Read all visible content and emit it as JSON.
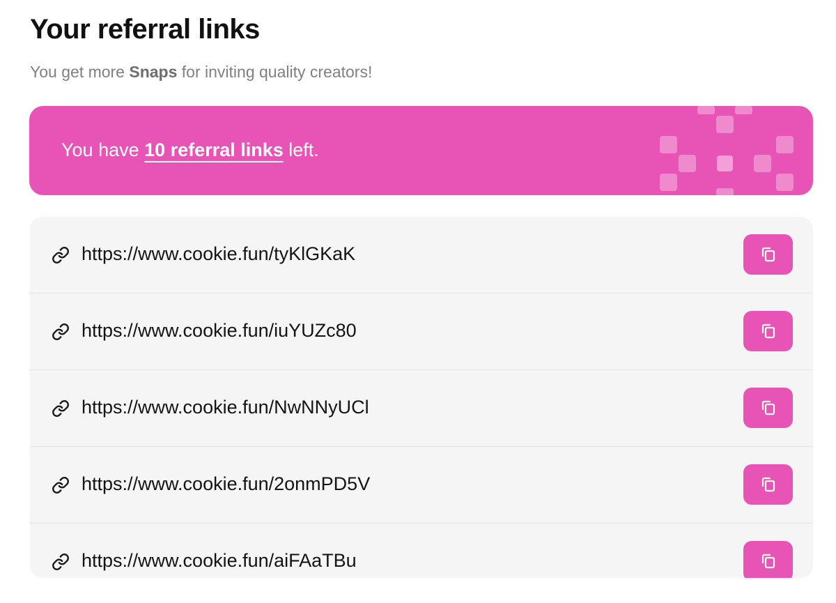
{
  "header": {
    "title": "Your referral links",
    "subtitle_prefix": "You get more ",
    "subtitle_strong": "Snaps",
    "subtitle_suffix": " for inviting quality creators!"
  },
  "banner": {
    "prefix": "You have ",
    "count_text": "10 referral links",
    "suffix": " left.",
    "color": "#e853b6"
  },
  "links": [
    {
      "icon": "link-icon",
      "url": "https://www.cookie.fun/tyKlGKaK",
      "action_icon": "copy-icon"
    },
    {
      "icon": "link-icon",
      "url": "https://www.cookie.fun/iuYUZc80",
      "action_icon": "copy-icon"
    },
    {
      "icon": "link-icon",
      "url": "https://www.cookie.fun/NwNNyUCl",
      "action_icon": "copy-icon"
    },
    {
      "icon": "link-icon",
      "url": "https://www.cookie.fun/2onmPD5V",
      "action_icon": "copy-icon"
    },
    {
      "icon": "link-icon",
      "url": "https://www.cookie.fun/aiFAaTBu",
      "action_icon": "copy-icon"
    }
  ]
}
